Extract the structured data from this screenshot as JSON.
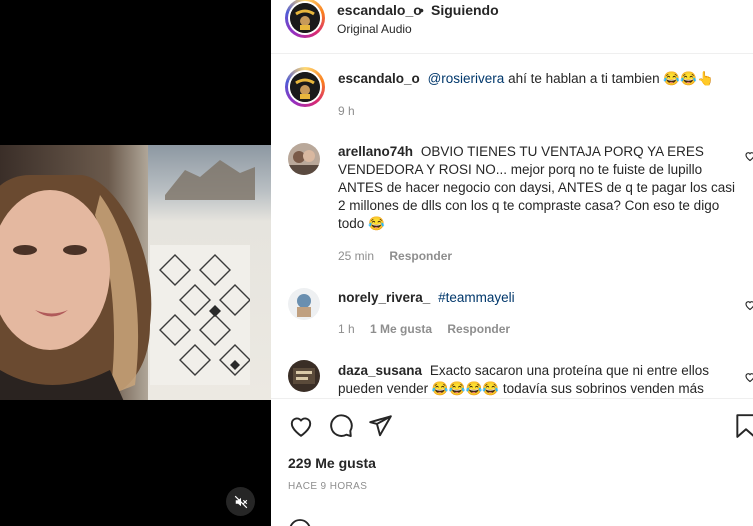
{
  "post": {
    "username": "escandalo_o",
    "follow_status": "Siguiendo",
    "separator": "•",
    "audio": "Original Audio",
    "likes": "229 Me gusta",
    "timestamp": "HACE 9 HORAS"
  },
  "comments": [
    {
      "username": "escandalo_o",
      "mention": "@rosierivera",
      "text": "ahí te hablan a ti tambien 😂😂👆",
      "time": "9 h"
    },
    {
      "username": "arellano74h",
      "text": "OBVIO TIENES TU VENTAJA PORQ YA ERES VENDEDORA Y ROSI NO... mejor porq no te fuiste de lupillo ANTES de hacer negocio con daysi, ANTES de q te pagar los casi 2 millones de dlls con los q te compraste casa? Con eso te digo todo 😂",
      "time": "25 min",
      "reply": "Responder"
    },
    {
      "username": "norely_rivera_",
      "mention": "#teammayeli",
      "time": "1 h",
      "likes": "1 Me gusta",
      "reply": "Responder"
    },
    {
      "username": "daza_susana",
      "text": "Exacto sacaron una proteína que ni entre ellos pueden vender 😂😂😂😂 todavía sus sobrinos venden más"
    }
  ],
  "icons": {
    "mute": "speaker-muted-icon",
    "like": "heart-icon",
    "comment": "comment-bubble-icon",
    "share": "paper-plane-icon",
    "save": "bookmark-icon"
  }
}
